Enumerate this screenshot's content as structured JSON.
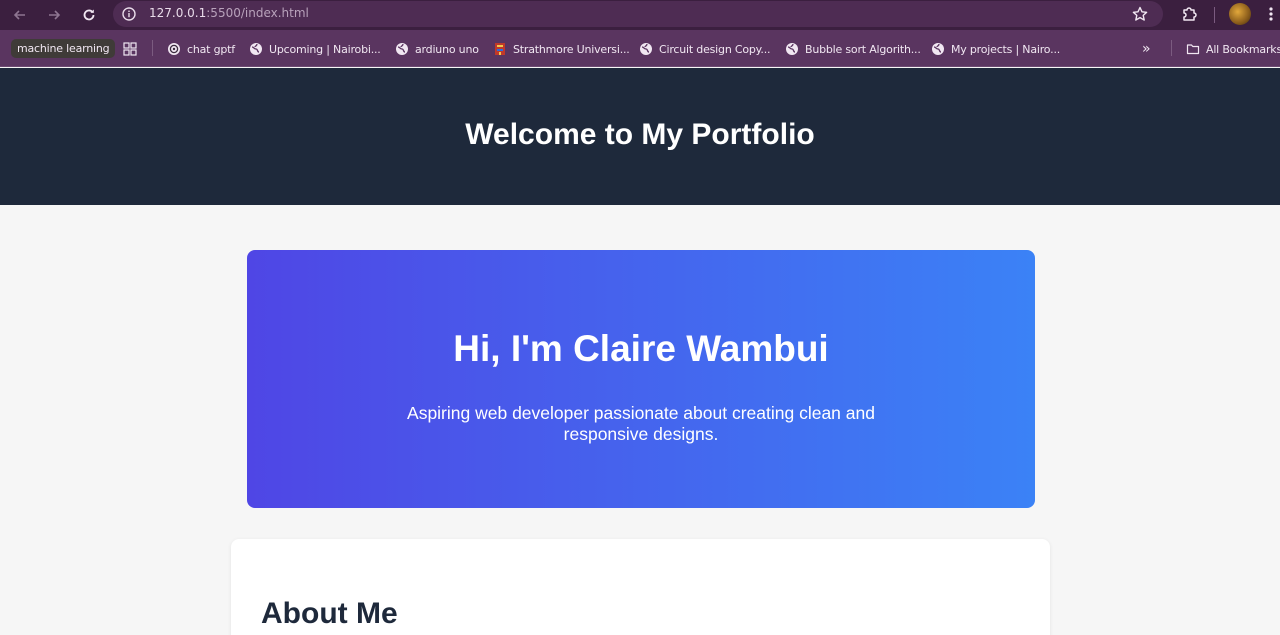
{
  "browser": {
    "url_host": "127.0.0.1",
    "url_rest": ":5500/index.html",
    "bookmarks": [
      {
        "label": "machine learning",
        "icon": "folder-chip"
      },
      {
        "label": "chat gptf",
        "icon": "openai-icon"
      },
      {
        "label": "Upcoming | Nairobi...",
        "icon": "globe-icon"
      },
      {
        "label": "ardiuno uno",
        "icon": "globe-icon"
      },
      {
        "label": "Strathmore Universi...",
        "icon": "strathmore-icon"
      },
      {
        "label": "Circuit design Copy...",
        "icon": "globe-icon"
      },
      {
        "label": "Bubble sort Algorith...",
        "icon": "globe-icon"
      },
      {
        "label": "My projects | Nairo...",
        "icon": "globe-icon"
      }
    ],
    "more_label": "»",
    "all_bookmarks": "All Bookmarks"
  },
  "page": {
    "header_title": "Welcome to My Portfolio",
    "hero_title": "Hi, I'm Claire Wambui",
    "hero_subtitle": "Aspiring web developer passionate about creating clean and responsive designs.",
    "about_title": "About Me"
  },
  "colors": {
    "header_bg": "#1e293b",
    "hero_gradient_start": "#4f46e5",
    "hero_gradient_end": "#3b82f6"
  }
}
